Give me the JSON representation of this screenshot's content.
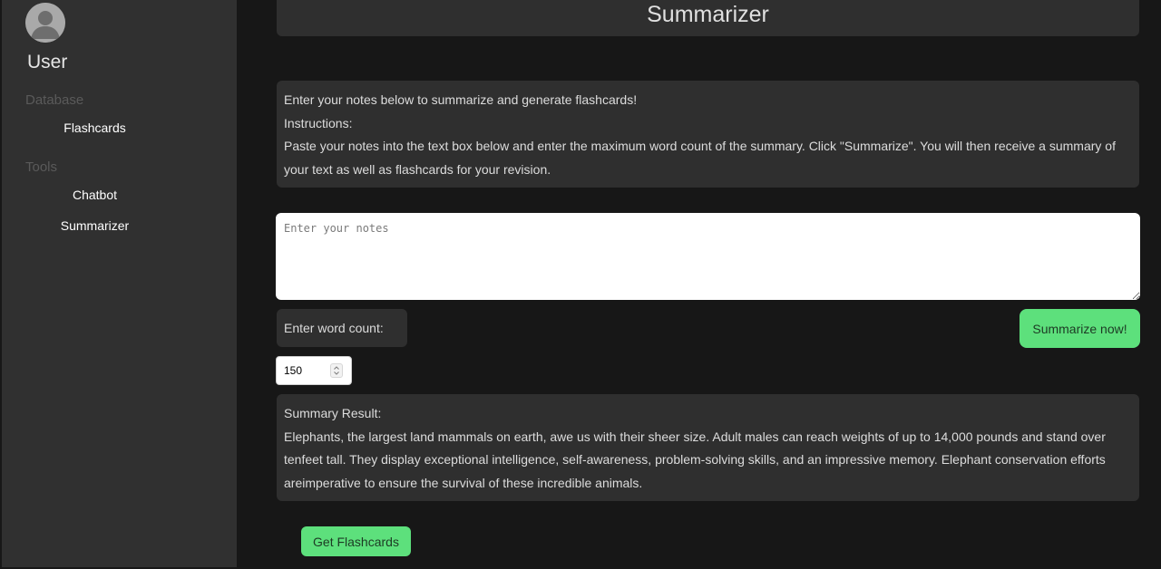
{
  "sidebar": {
    "user_name": "User",
    "sections": [
      {
        "title": "Database",
        "items": [
          {
            "label": "Flashcards"
          }
        ]
      },
      {
        "title": "Tools",
        "items": [
          {
            "label": "Chatbot"
          },
          {
            "label": "Summarizer"
          }
        ]
      }
    ]
  },
  "header": {
    "title": "Summarizer"
  },
  "instructions": {
    "intro": "Enter your notes below to summarize and generate flashcards!",
    "heading": "Instructions:",
    "body": "Paste your notes into the text box below and enter the maximum word count of the summary. Click \"Summarize\". You will then receive a summary of your text as well as flashcards for your revision."
  },
  "notes": {
    "placeholder": "Enter your notes",
    "value": ""
  },
  "word_count": {
    "label": "Enter word count:",
    "value": "150"
  },
  "actions": {
    "summarize_label": "Summarize now!",
    "flashcards_label": "Get Flashcards"
  },
  "result": {
    "heading": "Summary Result:",
    "text": "Elephants, the largest land mammals on earth, awe us with their sheer size. Adult males can reach weights of up to 14,000 pounds and stand over tenfeet tall. They display exceptional intelligence, self-awareness, problem-solving skills, and an impressive memory. Elephant conservation efforts areimperative to ensure the survival of these incredible animals."
  },
  "colors": {
    "background": "#171717",
    "panel": "#2f2f2f",
    "sidebar": "#303030",
    "accent": "#5de07c"
  }
}
